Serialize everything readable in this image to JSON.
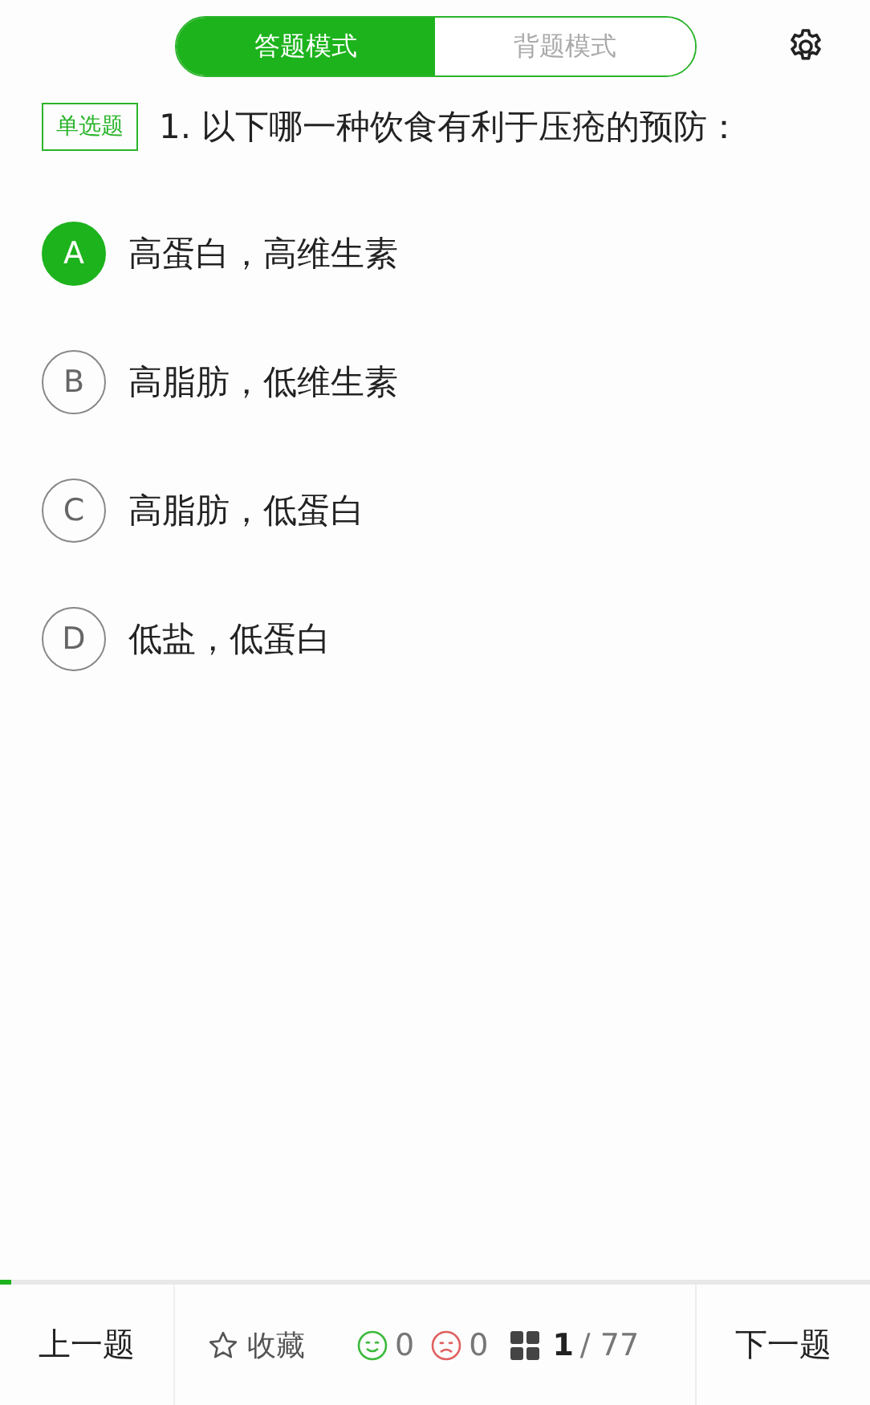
{
  "mode_tabs": [
    {
      "label": "答题模式",
      "selected": true
    },
    {
      "label": "背题模式",
      "selected": false
    }
  ],
  "question": {
    "type_tag": "单选题",
    "text": "1. 以下哪一种饮食有利于压疮的预防："
  },
  "options": [
    {
      "letter": "A",
      "text": "高蛋白，高维生素",
      "selected": true
    },
    {
      "letter": "B",
      "text": "高脂肪，低维生素",
      "selected": false
    },
    {
      "letter": "C",
      "text": "高脂肪，低蛋白",
      "selected": false
    },
    {
      "letter": "D",
      "text": "低盐，低蛋白",
      "selected": false
    }
  ],
  "progress": {
    "level": 0.013
  },
  "footer": {
    "prev": "上一题",
    "favorite": "收藏",
    "correct_count": "0",
    "wrong_count": "0",
    "current": "1",
    "total": "/ 77",
    "next": "下一题"
  }
}
